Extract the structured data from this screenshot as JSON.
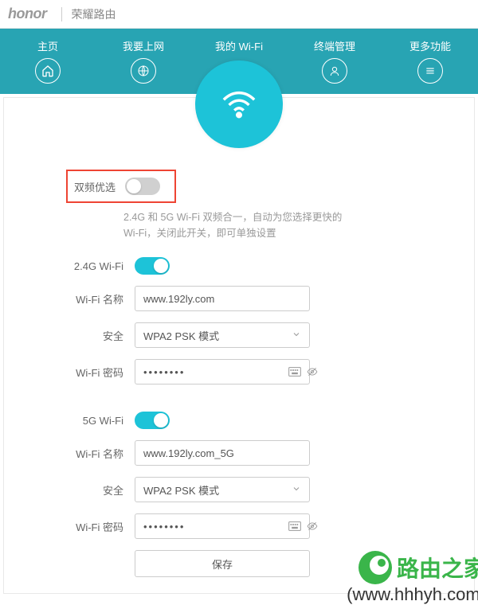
{
  "brand": {
    "logo_text": "honor",
    "title": "荣耀路由"
  },
  "nav": {
    "items": [
      {
        "label": "主页",
        "icon": "home"
      },
      {
        "label": "我要上网",
        "icon": "globe"
      },
      {
        "label": "我的 Wi-Fi",
        "icon": "wifi",
        "active": true
      },
      {
        "label": "终端管理",
        "icon": "user"
      },
      {
        "label": "更多功能",
        "icon": "menu"
      }
    ]
  },
  "wifi": {
    "dual_band": {
      "label": "双频优选",
      "enabled": false,
      "help_line1": "2.4G 和 5G Wi-Fi 双频合一，自动为您选择更快的",
      "help_line2": "Wi-Fi，关闭此开关，即可单独设置"
    },
    "band24": {
      "toggle_label": "2.4G Wi-Fi",
      "enabled": true,
      "name_label": "Wi-Fi 名称",
      "name_value": "www.192ly.com",
      "security_label": "安全",
      "security_value": "WPA2 PSK 模式",
      "password_label": "Wi-Fi 密码",
      "password_value": "••••••••"
    },
    "band5": {
      "toggle_label": "5G Wi-Fi",
      "enabled": true,
      "name_label": "Wi-Fi 名称",
      "name_value": "www.192ly.com_5G",
      "security_label": "安全",
      "security_value": "WPA2 PSK 模式",
      "password_label": "Wi-Fi 密码",
      "password_value": "••••••••"
    },
    "save_label": "保存"
  },
  "watermark": {
    "text": "路由之家",
    "url": "(www.hhhyh.com)"
  },
  "colors": {
    "accent": "#1dc3d8",
    "nav_bg": "#28a4b3",
    "highlight": "#e43",
    "watermark": "#3ab54a"
  }
}
